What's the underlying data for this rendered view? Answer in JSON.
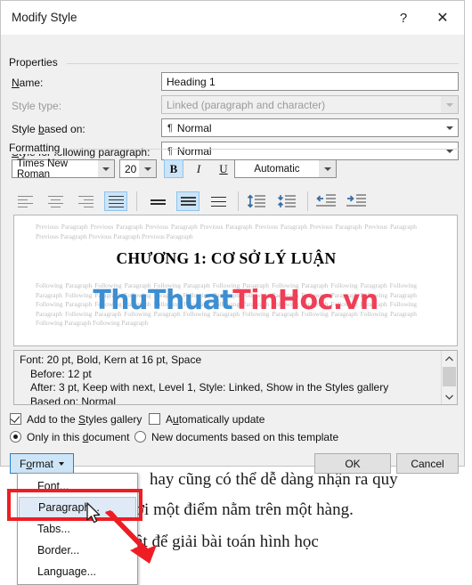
{
  "window": {
    "title": "Modify Style",
    "help_label": "?",
    "close_label": "✕"
  },
  "properties": {
    "group_label": "Properties",
    "name_label": "Name:",
    "name_value": "Heading 1",
    "style_type_label": "Style type:",
    "style_type_value": "Linked (paragraph and character)",
    "style_based_on_label": "Style based on:",
    "style_based_on_value": "Normal",
    "style_following_label": "Style for following paragraph:",
    "style_following_value": "Normal",
    "pilcrow": "¶"
  },
  "formatting": {
    "group_label": "Formatting",
    "font_family": "Times New Roman",
    "font_size": "20",
    "bold_label": "B",
    "italic_label": "I",
    "underline_label": "U",
    "font_color": "Automatic",
    "bold_active": true,
    "italic_active": false,
    "underline_active": false,
    "align_active": "justify",
    "line_spacing_active": "1.5",
    "buttons": {
      "align_left": "align-left",
      "align_center": "align-center",
      "align_right": "align-right",
      "justify": "justify",
      "spacing_single": "line-spacing-single",
      "spacing_one_half": "line-spacing-1.5",
      "spacing_double": "line-spacing-double",
      "space_increase": "increase-paragraph-spacing",
      "space_decrease": "decrease-paragraph-spacing",
      "indent_decrease": "decrease-indent",
      "indent_increase": "increase-indent"
    }
  },
  "preview": {
    "previous_paragraph": "Previous Paragraph Previous Paragraph Previous Paragraph Previous Paragraph Previous Paragraph Previous Paragraph Previous Paragraph Previous Paragraph Previous Paragraph Previous Paragraph",
    "heading": "CHƯƠNG 1: CƠ SỞ LÝ LUẬN",
    "following_paragraph": "Following Paragraph Following Paragraph Following Paragraph Following Paragraph Following Paragraph Following Paragraph Following Paragraph Following Paragraph Following Paragraph Following Paragraph Following Paragraph Following Paragraph Following Paragraph Following Paragraph Following Paragraph Following Paragraph Following Paragraph Following Paragraph Following Paragraph Following Paragraph Following Paragraph Following Paragraph Following Paragraph Following Paragraph Following Paragraph Following Paragraph Following Paragraph Following Paragraph",
    "watermark_part1": "ThuThuat",
    "watermark_part2": "TinHoc.vn",
    "watermark_color1": "#3d8fd1",
    "watermark_color2": "#ef3e56"
  },
  "description": {
    "line1": "Font: 20 pt, Bold, Kern at 16 pt, Space",
    "line2": "Before:  12 pt",
    "line3": "After:  3 pt, Keep with next, Level 1, Style: Linked, Show in the Styles gallery",
    "line4": "Based on: Normal"
  },
  "options": {
    "add_to_gallery_label": "Add to the Styles gallery",
    "add_to_gallery_checked": true,
    "auto_update_label": "Automatically update",
    "auto_update_checked": false,
    "only_this_document_label": "Only in this document",
    "only_this_document_selected": true,
    "new_documents_label": "New documents based on this template",
    "new_documents_selected": false
  },
  "footer": {
    "format_label": "Format",
    "ok_label": "OK",
    "cancel_label": "Cancel"
  },
  "format_menu": {
    "items": [
      {
        "label": "Font...",
        "selected": false
      },
      {
        "label": "Paragraph...",
        "selected": true
      },
      {
        "label": "Tabs...",
        "selected": false
      },
      {
        "label": "Border...",
        "selected": false
      },
      {
        "label": "Language...",
        "selected": false
      }
    ]
  },
  "background_document": {
    "line1": "hay cũng có thể dễ dàng nhận ra quy",
    "line2": "ới một điểm nằm trên một hàng.",
    "line3": "ật để giải bài toán hình học"
  },
  "annotation": {
    "highlight_color": "#ee1d24"
  }
}
